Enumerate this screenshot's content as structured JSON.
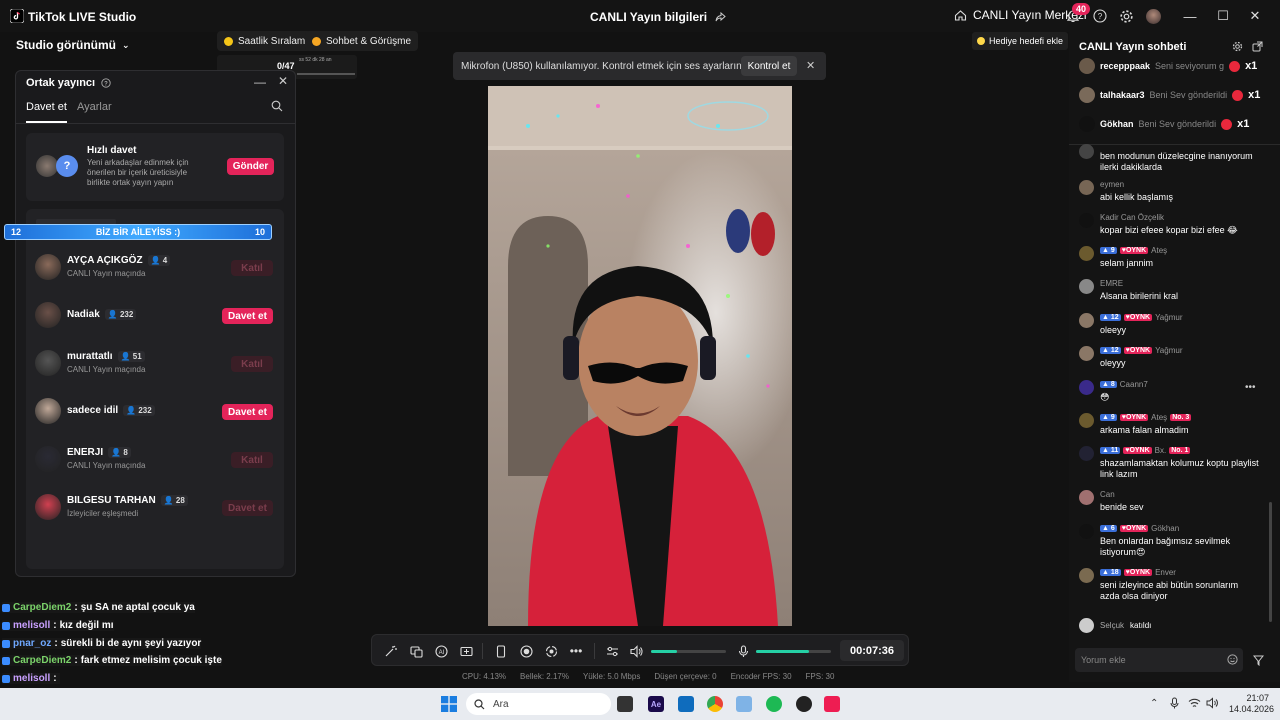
{
  "app": {
    "title": "TikTok LIVE Studio",
    "center_title": "CANLI Yayın bilgileri",
    "center_label": "CANLI Yayın Merkezi",
    "notif_count": "40"
  },
  "left": {
    "studio_view": "Studio görünümü",
    "pill_rank": "Saatlik Sıralama",
    "pill_chat": "Sohbet & Görüşme",
    "mini_counter": "0/47",
    "mini_time": "ss 52 dk 28 an"
  },
  "cohost": {
    "title": "Ortak yayıncı",
    "tab_invite": "Davet et",
    "tab_settings": "Ayarlar",
    "quick_title": "Hızlı davet",
    "quick_desc": "Yeni arkadaşlar edinmek için önerilen bir içerik üreticisiyle birlikte ortak yayın yapın",
    "quick_button": "Gönder",
    "users": [
      {
        "name": "AYÇA AÇIKGÖZ",
        "count": "4",
        "sub": "CANLI Yayın maçında",
        "button": "Katıl",
        "active": false
      },
      {
        "name": "Nadiak",
        "count": "232",
        "sub": "",
        "button": "Davet et",
        "active": true
      },
      {
        "name": "murattatlı",
        "count": "51",
        "sub": "CANLI Yayın maçında",
        "button": "Katıl",
        "active": false
      },
      {
        "name": "sadece idil",
        "count": "232",
        "sub": "",
        "button": "Davet et",
        "active": true
      },
      {
        "name": "ENERJI",
        "count": "8",
        "sub": "CANLI Yayın maçında",
        "button": "Katıl",
        "active": false
      },
      {
        "name": "BILGESU TARHAN",
        "count": "28",
        "sub": "İzleyiciler eşleşmedi",
        "button": "Davet et",
        "active": false
      }
    ]
  },
  "banner": {
    "left": "12",
    "text": "BİZ BİR AİLEYİSS :)",
    "right": "10"
  },
  "overlay_chat": [
    {
      "name": "CarpeDiem2",
      "text": "şu SA ne aptal çocuk ya",
      "color": "#7bd36a"
    },
    {
      "name": "melisoll",
      "text": "kız değil mı",
      "color": "#c9a0ff"
    },
    {
      "name": "pnar_oz",
      "text": "sürekli bi de aynı şeyi yazıyor",
      "color": "#6fa8ff"
    },
    {
      "name": "CarpeDiem2",
      "text": "fark etmez melisim çocuk işte",
      "color": "#7bd36a"
    },
    {
      "name": "melisoll",
      "text": "",
      "color": "#c9a0ff"
    }
  ],
  "notification": {
    "text": "Mikrofon (U850) kullanılamıyor. Kontrol etmek için ses ayarlarını açın.",
    "button": "Kontrol et"
  },
  "goal_button": "Hediye hedefi ekle",
  "controls": {
    "timer": "00:07:36",
    "volume_level": 0.35,
    "mic_level": 0.7
  },
  "stats": {
    "cpu": "CPU: 4.13%",
    "mem": "Bellek: 2.17%",
    "upload": "Yükle: 5.0 Mbps",
    "dropped": "Düşen çerçeve: 0",
    "encoder": "Encoder FPS: 30",
    "fps": "FPS: 30"
  },
  "chat": {
    "title": "CANLI Yayın sohbeti",
    "gifts": [
      {
        "user": "recepppaak",
        "text": "Seni seviyorum g",
        "count": "x1"
      },
      {
        "user": "talhakaar3",
        "text": "Beni Sev gönderildi",
        "count": "x1"
      },
      {
        "user": "Gökhan",
        "text": "Beni Sev gönderildi",
        "count": "x1"
      }
    ],
    "messages": [
      {
        "name": "",
        "level": "",
        "oynk": false,
        "no": "",
        "text": "ben modunun düzelecgine inanıyorum ilerki dakiklarda",
        "av": "#444"
      },
      {
        "name": "eymen",
        "level": "",
        "oynk": false,
        "no": "",
        "text": "abi kellik başlamış",
        "av": "#776655"
      },
      {
        "name": "Kadir Can Özçelik",
        "level": "",
        "oynk": false,
        "no": "",
        "text": "kopar bizi efeee kopar bizi efee 😂",
        "av": "#111"
      },
      {
        "name": "Ateş",
        "level": "9",
        "oynk": true,
        "no": "",
        "text": "selam jannim",
        "av": "#6b5a2e"
      },
      {
        "name": "EMRE",
        "level": "",
        "oynk": false,
        "no": "",
        "text": "Alsana birilerini kral",
        "av": "#888"
      },
      {
        "name": "Yağmur",
        "level": "12",
        "oynk": true,
        "no": "",
        "text": "oleeyy",
        "av": "#8a7766"
      },
      {
        "name": "Yağmur",
        "level": "12",
        "oynk": true,
        "no": "",
        "text": "oleyyy",
        "av": "#8a7766"
      },
      {
        "name": "Caann7",
        "level": "8",
        "oynk": false,
        "no": "",
        "text": "😳",
        "av": "#3a2a8a"
      },
      {
        "name": "Ateş",
        "level": "9",
        "oynk": true,
        "no": "No. 3",
        "text": "arkama falan almadim",
        "av": "#6b5a2e"
      },
      {
        "name": "Bx.",
        "level": "11",
        "oynk": true,
        "no": "No. 1",
        "text": "shazamlamaktan kolumuz koptu playlist link lazım",
        "av": "#223"
      },
      {
        "name": "Can",
        "level": "",
        "oynk": false,
        "no": "",
        "text": "benide sev",
        "av": "#a07070"
      },
      {
        "name": "Gökhan",
        "level": "6",
        "oynk": true,
        "no": "",
        "text": "Ben onlardan bağımsız sevilmek istiyorum😍",
        "av": "#111"
      },
      {
        "name": "Enver",
        "level": "18",
        "oynk": true,
        "no": "",
        "text": "seni izleyince abi bütün sorunlarım azda olsa diniyor",
        "av": "#7a6a50"
      }
    ],
    "joined_user": "Selçuk",
    "joined_text": "katıldı",
    "input_placeholder": "Yorum ekle",
    "oynk_label": "OYNK"
  },
  "taskbar": {
    "search": "Ara",
    "time": "21:07",
    "date": "14.04.2026"
  }
}
